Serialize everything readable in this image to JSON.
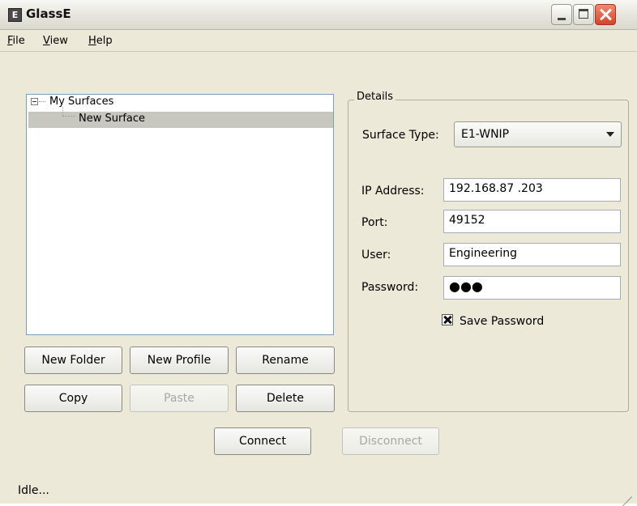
{
  "window": {
    "title": "GlassE",
    "app_icon_letter": "E"
  },
  "menubar": {
    "items": [
      "File",
      "View",
      "Help"
    ]
  },
  "tree": {
    "root": {
      "label": "My Surfaces",
      "expanded": true
    },
    "children": [
      {
        "label": "New Surface",
        "selected": true
      }
    ]
  },
  "buttons": {
    "new_folder": "New Folder",
    "new_profile": "New Profile",
    "rename": "Rename",
    "copy": "Copy",
    "paste": "Paste",
    "delete": "Delete",
    "connect": "Connect",
    "disconnect": "Disconnect"
  },
  "details": {
    "legend": "Details",
    "surface_type": {
      "label": "Surface Type:",
      "value": "E1-WNIP"
    },
    "ip_address": {
      "label": "IP Address:",
      "value": "192.168.87 .203"
    },
    "port": {
      "label": "Port:",
      "value": "49152"
    },
    "user": {
      "label": "User:",
      "value": "Engineering"
    },
    "password": {
      "label": "Password:",
      "value": "●●●"
    },
    "save_password": {
      "label": "Save Password",
      "checked": true
    }
  },
  "statusbar": {
    "text": "Idle..."
  },
  "icons": {
    "app": "app-icon",
    "minimize": "minimize-icon",
    "maximize": "maximize-icon",
    "close": "close-icon",
    "tree_toggle": "collapse-icon",
    "dropdown": "chevron-down-icon",
    "checkbox": "checkbox-checked-icon",
    "grip": "resize-grip-icon"
  }
}
